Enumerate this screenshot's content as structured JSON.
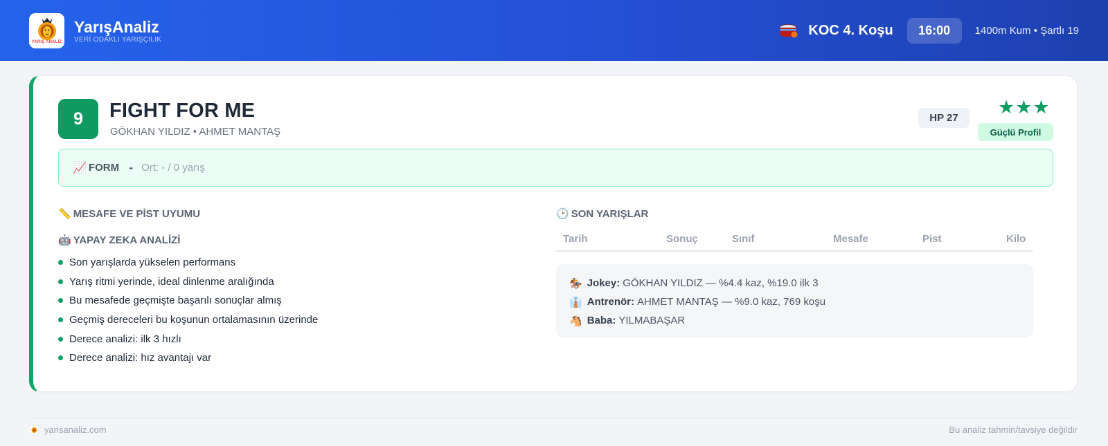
{
  "header": {
    "brand_name": "YarışAnaliz",
    "brand_tagline": "VERİ ODAKLI YARIŞÇILIK",
    "logo_text": "YARIŞ ANALİZ",
    "race_title": "KOC 4. Koşu",
    "race_time": "16:00",
    "race_details": "1400m Kum • Şartlı 19"
  },
  "horse": {
    "number": "9",
    "name": "FIGHT FOR ME",
    "subtitle": "GÖKHAN YILDIZ • AHMET MANTAŞ",
    "hp": "HP 27",
    "stars": "★★★",
    "star_count": 3,
    "profile_badge": "Güçlü Profil"
  },
  "form": {
    "emoji": "📈",
    "label": "FORM",
    "value": "-",
    "average": "Ort: - / 0 yarış"
  },
  "distance_section": {
    "emoji": "📏",
    "title": "MESAFE VE PİST UYUMU"
  },
  "ai_section": {
    "emoji": "🤖",
    "title": "YAPAY ZEKA ANALİZİ",
    "items": [
      "Son yarışlarda yükselen performans",
      "Yarış ritmi yerinde, ideal dinlenme aralığında",
      "Bu mesafede geçmişte başarılı sonuçlar almış",
      "Geçmiş dereceleri bu koşunun ortalamasının üzerinde",
      "Derece analizi: ilk 3 hızlı",
      "Derece analizi: hız avantajı var"
    ]
  },
  "recent_races": {
    "emoji": "🕑",
    "title": "SON YARIŞLAR",
    "columns": [
      "Tarih",
      "Sonuç",
      "Sınıf",
      "Mesafe",
      "Pist",
      "Kilo"
    ],
    "rows": []
  },
  "info": {
    "jockey_emoji": "🏇",
    "jockey_label": "Jokey:",
    "jockey_value": "GÖKHAN YILDIZ — %4.4 kaz, %19.0 ilk 3",
    "trainer_emoji": "👔",
    "trainer_label": "Antrenör:",
    "trainer_value": "AHMET MANTAŞ — %9.0 kaz, 769 koşu",
    "sire_emoji": "🐴",
    "sire_label": "Baba:",
    "sire_value": "YILMABAŞAR"
  },
  "footer": {
    "site": "yarisanaliz.com",
    "disclaimer": "Bu analiz tahmin/tavsiye değildir"
  },
  "colors": {
    "header_blue": "#2563eb",
    "accent_green": "#16a36a",
    "badge_green": "#109a62",
    "form_bg": "#ecfdf5"
  }
}
